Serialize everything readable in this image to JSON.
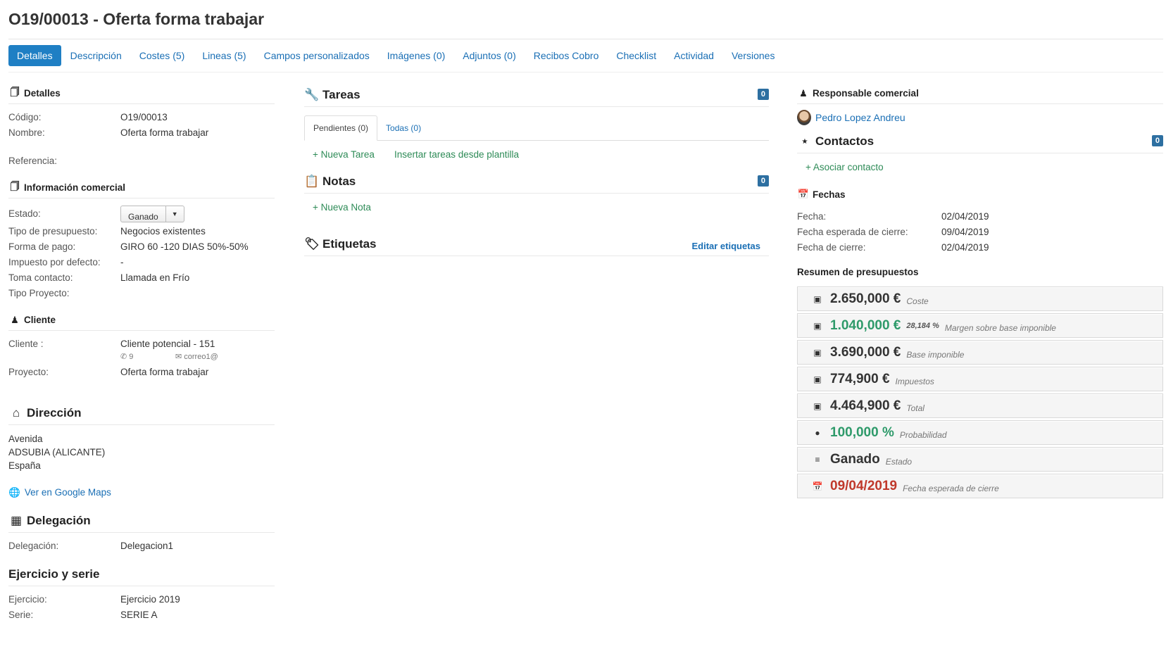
{
  "header": {
    "title": "O19/00013 - Oferta forma trabajar"
  },
  "tabs": [
    {
      "label": "Detalles"
    },
    {
      "label": "Descripción"
    },
    {
      "label": "Costes (5)"
    },
    {
      "label": "Lineas (5)"
    },
    {
      "label": "Campos personalizados"
    },
    {
      "label": "Imágenes (0)"
    },
    {
      "label": "Adjuntos (0)"
    },
    {
      "label": "Recibos Cobro"
    },
    {
      "label": "Checklist"
    },
    {
      "label": "Actividad"
    },
    {
      "label": "Versiones"
    }
  ],
  "detalles": {
    "heading": "Detalles",
    "codigo_label": "Código:",
    "codigo": "O19/00013",
    "nombre_label": "Nombre:",
    "nombre": "Oferta forma trabajar",
    "referencia_label": "Referencia:"
  },
  "info": {
    "heading": "Información comercial",
    "estado_label": "Estado:",
    "estado": "Ganado",
    "tipo_label": "Tipo de presupuesto:",
    "tipo": "Negocios existentes",
    "pago_label": "Forma de pago:",
    "pago": "GIRO 60 -120 DIAS 50%-50%",
    "impuesto_label": "Impuesto por defecto:",
    "impuesto": "-",
    "toma_label": "Toma contacto:",
    "toma": "Llamada en Frío",
    "proyecto_tipo_label": "Tipo Proyecto:"
  },
  "cliente": {
    "heading": "Cliente",
    "cliente_label": "Cliente :",
    "cliente": "Cliente potencial - 151",
    "phone": "9",
    "email": "correo1@",
    "proyecto_label": "Proyecto:",
    "proyecto": "Oferta forma trabajar"
  },
  "direccion": {
    "heading": "Dirección",
    "line1": "Avenida",
    "line2": "ADSUBIA (ALICANTE)",
    "line3": "España",
    "maps_link": "Ver en Google Maps"
  },
  "delegacion": {
    "heading": "Delegación",
    "label": "Delegación:",
    "value": "Delegacion1"
  },
  "ejercicio": {
    "heading": "Ejercicio y serie",
    "ej_label": "Ejercicio:",
    "ej": "Ejercicio 2019",
    "serie_label": "Serie:",
    "serie": "SERIE A"
  },
  "tareas": {
    "heading": "Tareas",
    "badge": "0",
    "tab_pendientes": "Pendientes (0)",
    "tab_todas": "Todas (0)",
    "nueva": "+ Nueva Tarea",
    "plantilla": "Insertar tareas desde plantilla"
  },
  "notas": {
    "heading": "Notas",
    "badge": "0",
    "nueva": "+ Nueva Nota"
  },
  "etiquetas": {
    "heading": "Etiquetas",
    "editar": "Editar etiquetas"
  },
  "responsable": {
    "heading": "Responsable comercial",
    "name": "Pedro Lopez Andreu"
  },
  "contactos": {
    "heading": "Contactos",
    "badge": "0",
    "asociar": "+ Asociar contacto"
  },
  "fechas": {
    "heading": "Fechas",
    "fecha_label": "Fecha:",
    "fecha": "02/04/2019",
    "esperada_label": "Fecha esperada de cierre:",
    "esperada": "09/04/2019",
    "cierre_label": "Fecha de cierre:",
    "cierre": "02/04/2019"
  },
  "resumen": {
    "heading": "Resumen de presupuestos",
    "coste": "2.650,000 €",
    "coste_lbl": "Coste",
    "margen": "1.040,000 €",
    "margen_pct": "28,184 %",
    "margen_lbl": "Margen sobre base imponible",
    "base": "3.690,000 €",
    "base_lbl": "Base imponible",
    "impuestos": "774,900 €",
    "impuestos_lbl": "Impuestos",
    "total": "4.464,900 €",
    "total_lbl": "Total",
    "prob": "100,000 %",
    "prob_lbl": "Probabilidad",
    "estado": "Ganado",
    "estado_lbl": "Estado",
    "fecha": "09/04/2019",
    "fecha_lbl": "Fecha esperada de cierre"
  },
  "colors": {
    "accent": "#1f7fc4",
    "link": "#1a6fb5",
    "green": "#2e9a6a",
    "red": "#c0392b",
    "badge": "#2d6fa1"
  }
}
